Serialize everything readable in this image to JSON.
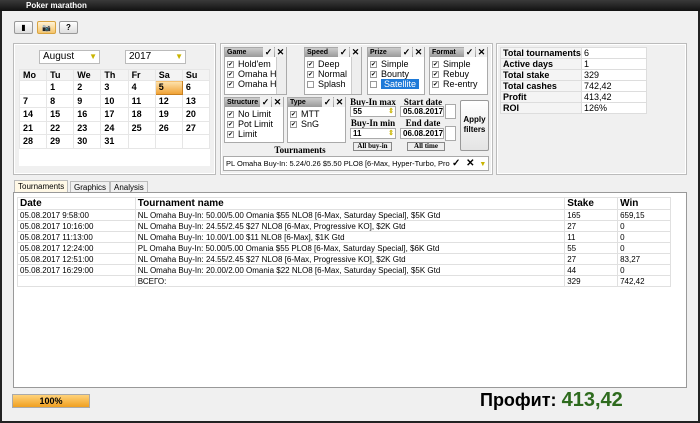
{
  "window": {
    "title": "Poker marathon"
  },
  "toolbar": {
    "buttons": [
      {
        "icon": "database-icon",
        "glyph": "▮"
      },
      {
        "icon": "camera-icon",
        "glyph": "📷"
      },
      {
        "icon": "help-icon",
        "glyph": "?"
      }
    ]
  },
  "calendar": {
    "month": "August",
    "year": "2017",
    "weekdays": [
      "Mo",
      "Tu",
      "We",
      "Th",
      "Fr",
      "Sa",
      "Su"
    ],
    "weeks": [
      [
        "",
        "1",
        "2",
        "3",
        "4",
        "5",
        "6"
      ],
      [
        "7",
        "8",
        "9",
        "10",
        "11",
        "12",
        "13"
      ],
      [
        "14",
        "15",
        "16",
        "17",
        "18",
        "19",
        "20"
      ],
      [
        "21",
        "22",
        "23",
        "24",
        "25",
        "26",
        "27"
      ],
      [
        "28",
        "29",
        "30",
        "31",
        "",
        "",
        ""
      ]
    ],
    "selected": "5"
  },
  "filters": {
    "game": {
      "title": "Game",
      "items": [
        {
          "label": "Hold'em",
          "checked": true
        },
        {
          "label": "Omaha Hi",
          "checked": true
        },
        {
          "label": "Omaha H/L",
          "checked": true
        }
      ]
    },
    "speed": {
      "title": "Speed",
      "items": [
        {
          "label": "Deep",
          "checked": true
        },
        {
          "label": "Normal",
          "checked": true
        },
        {
          "label": "Splash",
          "checked": false
        }
      ]
    },
    "prize": {
      "title": "Prize",
      "items": [
        {
          "label": "Simple",
          "checked": true
        },
        {
          "label": "Bounty",
          "checked": true
        },
        {
          "label": "Satellite",
          "checked": false
        }
      ]
    },
    "format": {
      "title": "Format",
      "items": [
        {
          "label": "Simple",
          "checked": true
        },
        {
          "label": "Rebuy",
          "checked": true
        },
        {
          "label": "Re-entry",
          "checked": true
        }
      ]
    },
    "structure": {
      "title": "Structure",
      "items": [
        {
          "label": "No Limit",
          "checked": true
        },
        {
          "label": "Pot Limit",
          "checked": true
        },
        {
          "label": "Limit",
          "checked": true
        }
      ]
    },
    "type": {
      "title": "Type",
      "items": [
        {
          "label": "MTT",
          "checked": true
        },
        {
          "label": "SnG",
          "checked": true
        }
      ]
    },
    "ok": "✓",
    "x": "✕",
    "buyin_max_label": "Buy-In max",
    "buyin_max": "55",
    "buyin_min_label": "Buy-In min",
    "buyin_min": "11",
    "start_date_label": "Start date",
    "start_date": "05.08.2017",
    "end_date_label": "End date",
    "end_date": "06.08.2017",
    "all_buyin": "All buy-in",
    "all_time": "All time",
    "apply": "Apply filters",
    "tournaments_label": "Tournaments",
    "tournament_combo": "PL Omaha Buy-In: 5.24/0.26 $5.50 PLO8 [6-Max, Hyper-Turbo, Progres"
  },
  "stats": [
    {
      "k": "Total tournaments",
      "v": "6"
    },
    {
      "k": "Active days",
      "v": "1"
    },
    {
      "k": "Total stake",
      "v": "329"
    },
    {
      "k": "Total cashes",
      "v": "742,42"
    },
    {
      "k": "Profit",
      "v": "413,42"
    },
    {
      "k": "ROI",
      "v": "126%"
    }
  ],
  "tabs": [
    "Tournaments",
    "Graphics",
    "Analysis"
  ],
  "table": {
    "columns": [
      "Date",
      "Tournament name",
      "Stake",
      "Win"
    ],
    "rows": [
      [
        "05.08.2017 9:58:00",
        "NL Omaha Buy-In: 50.00/5.00 Omania $55 NLO8 [6-Max, Saturday Special], $5K Gtd",
        "165",
        "659,15"
      ],
      [
        "05.08.2017 10:16:00",
        "NL Omaha Buy-In: 24.55/2.45 $27 NLO8 [6-Max, Progressive KO], $2K Gtd",
        "27",
        "0"
      ],
      [
        "05.08.2017 11:13:00",
        "NL Omaha Buy-In: 10.00/1.00 $11 NLO8 [6-Max], $1K Gtd",
        "11",
        "0"
      ],
      [
        "05.08.2017 12:24:00",
        "PL Omaha Buy-In: 50.00/5.00 Omania $55 PLO8 [6-Max, Saturday Special], $6K Gtd",
        "55",
        "0"
      ],
      [
        "05.08.2017 12:51:00",
        "NL Omaha Buy-In: 24.55/2.45 $27 NLO8 [6-Max, Progressive KO], $2K Gtd",
        "27",
        "83,27"
      ],
      [
        "05.08.2017 16:29:00",
        "NL Omaha Buy-In: 20.00/2.00 Omania $22 NLO8 [6-Max, Saturday Special], $5K Gtd",
        "44",
        "0"
      ],
      [
        "",
        "ВСЕГО:",
        "329",
        "742,42"
      ]
    ]
  },
  "progress": {
    "value": 100,
    "label": "100%"
  },
  "profit": {
    "label": "Профит:",
    "value": "413,42"
  }
}
